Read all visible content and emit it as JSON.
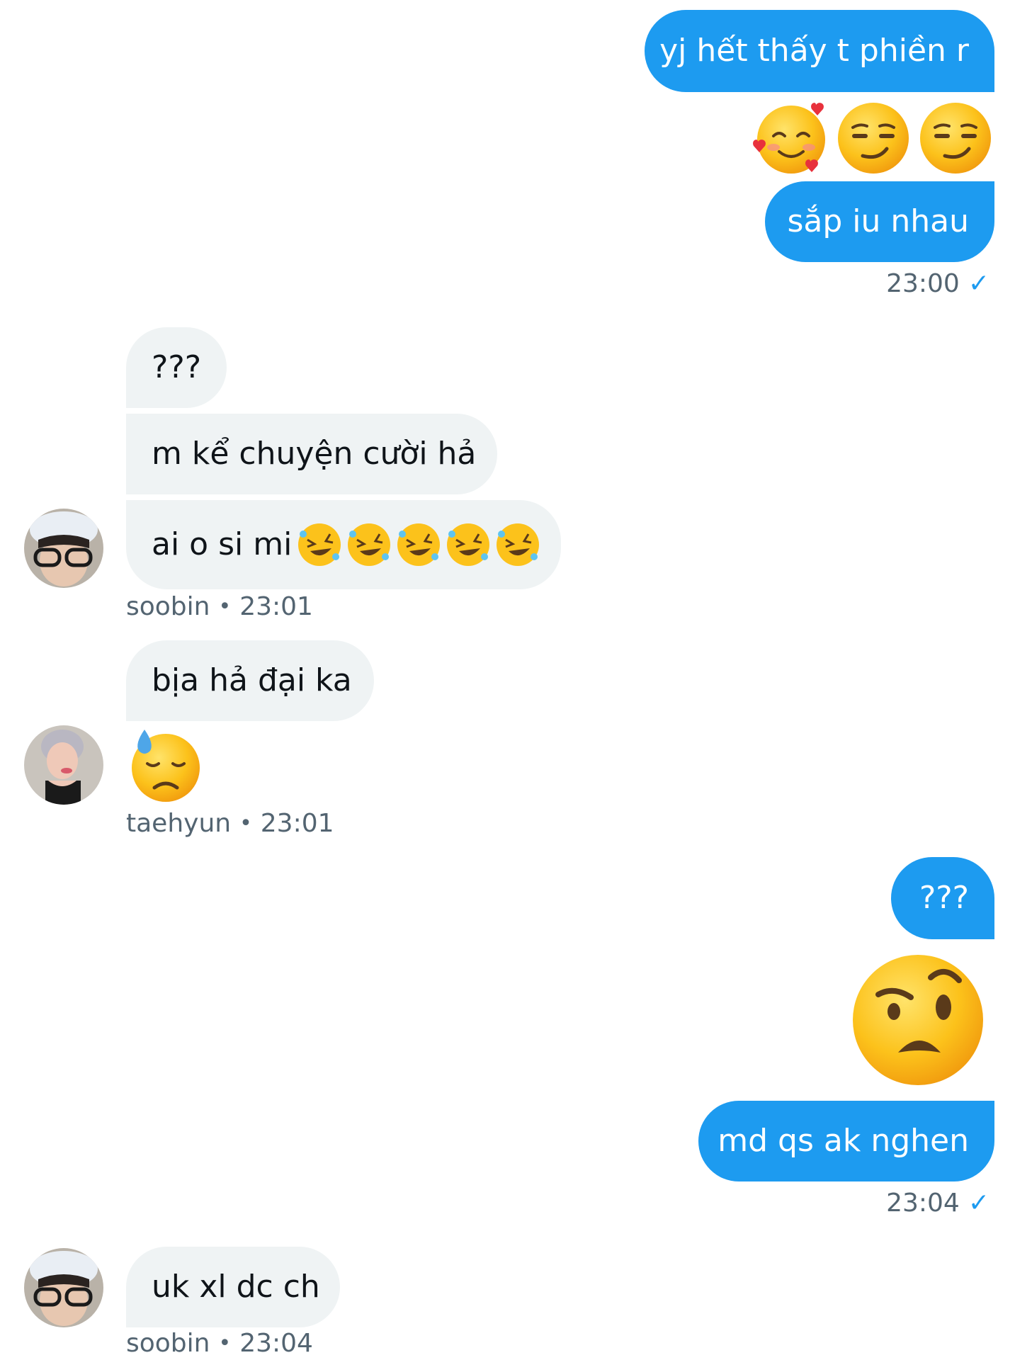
{
  "colors": {
    "accent": "#1d9bf0",
    "incoming_bg": "#eff3f4",
    "meta": "#536471"
  },
  "messages": {
    "m1": "yj hết thấy t phiền r",
    "m1_emojis": [
      "smiling-face-with-hearts",
      "smirking-face",
      "smirking-face"
    ],
    "m2": "sắp iu nhau",
    "m2_time": "23:00",
    "m3": "???",
    "m4": "m kể chuyện cười hả",
    "m5": "ai o si mi",
    "m5_emojis": [
      "rolling-on-floor-laughing",
      "rolling-on-floor-laughing",
      "rolling-on-floor-laughing",
      "rolling-on-floor-laughing",
      "rolling-on-floor-laughing"
    ],
    "m5_sender": "soobin",
    "m5_time": "23:01",
    "m6": "bịa hả đại ka",
    "m7_emoji": "downcast-face-with-sweat",
    "m7_sender": "taehyun",
    "m7_time": "23:01",
    "m8": "???",
    "m9_emoji": "face-with-raised-eyebrow",
    "m10": "md qs ak nghen",
    "m10_time": "23:04",
    "m11": "uk xl dc ch",
    "m11_sender": "soobin",
    "m11_time": "23:04"
  },
  "meta": {
    "separator": "•",
    "check": "✓"
  }
}
